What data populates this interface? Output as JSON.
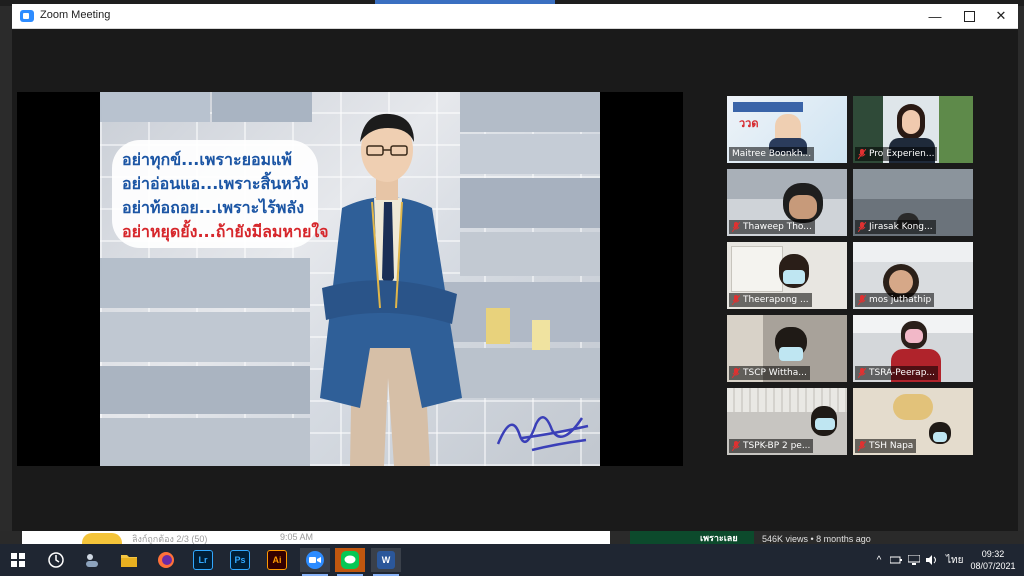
{
  "window": {
    "title": "Zoom Meeting",
    "minimize_glyph": "—",
    "close_glyph": "✕"
  },
  "slide": {
    "quote_lines": [
      "อย่าทุกข์...เพราะยอมแพ้",
      "อย่าอ่อนแอ...เพราะสิ้นหวัง",
      "อย่าท้อถอย...เพราะไร้พลัง",
      "อย่าหยุดยั้ง...ถ้ายังมีลมหายใจ"
    ],
    "quote_colors": [
      "#1b55a4",
      "#1b55a4",
      "#1b55a4",
      "#d6262b"
    ]
  },
  "participants": [
    {
      "name": "Maitree Boonkh...",
      "muted": false,
      "active": true
    },
    {
      "name": "Pro Experien...",
      "muted": true,
      "active": false
    },
    {
      "name": "Thaweep Tho...",
      "muted": true,
      "active": false
    },
    {
      "name": "Jirasak Kong...",
      "muted": true,
      "active": false
    },
    {
      "name": "Theerapong ...",
      "muted": true,
      "active": false
    },
    {
      "name": "mos juthathip",
      "muted": true,
      "active": false
    },
    {
      "name": "TSCP Wittha...",
      "muted": true,
      "active": false
    },
    {
      "name": "TSRA-Peerap...",
      "muted": true,
      "active": false
    },
    {
      "name": "TSPK-BP 2 pe...",
      "muted": true,
      "active": false
    },
    {
      "name": "TSH Napa",
      "muted": true,
      "active": false
    }
  ],
  "underlying_page": {
    "time_text": "9:05 AM",
    "partial_text": "ลิงก์ถูกต้อง 2/3 (50)",
    "video_label": "เพราะเลย",
    "views_text": "546K views • 8 months ago"
  },
  "taskbar": {
    "apps": [
      "windows-start",
      "task-view",
      "explorer-folder",
      "firefox",
      "lightroom",
      "photoshop",
      "illustrator",
      "zoom",
      "line",
      "word"
    ],
    "app_labels": {
      "lightroom": "Lr",
      "photoshop": "Ps",
      "illustrator": "Ai",
      "word": "W"
    },
    "language": "ไทย",
    "time": "09:32",
    "date": "08/07/2021",
    "tray_chevron": "^"
  },
  "colors": {
    "zoom_blue": "#2d8cff",
    "active_speaker_outline": "#e9e46a",
    "mute_red": "#e03131"
  }
}
